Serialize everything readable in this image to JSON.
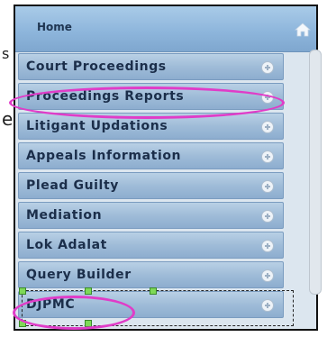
{
  "fragments": {
    "left_s": "s",
    "left_e": "e"
  },
  "menu": {
    "header_title": "Home",
    "header_icon": "home-icon",
    "items": [
      {
        "label": "Court Proceedings",
        "icon": "plus-circle-icon"
      },
      {
        "label": "Proceedings Reports",
        "icon": "plus-circle-icon"
      },
      {
        "label": "Litigant Updations",
        "icon": "plus-circle-icon"
      },
      {
        "label": "Appeals Information",
        "icon": "plus-circle-icon"
      },
      {
        "label": "Plead Guilty",
        "icon": "plus-circle-icon"
      },
      {
        "label": "Mediation",
        "icon": "plus-circle-icon"
      },
      {
        "label": "Lok Adalat",
        "icon": "plus-circle-icon"
      },
      {
        "label": "Query Builder",
        "icon": "plus-circle-icon"
      },
      {
        "label": "DJPMC",
        "icon": "plus-circle-icon"
      }
    ]
  },
  "colors": {
    "highlight": "#e03cc8",
    "item_gradient_top": "#b9d0e5",
    "item_gradient_bottom": "#8dadcf",
    "item_text": "#1b2e4a"
  }
}
